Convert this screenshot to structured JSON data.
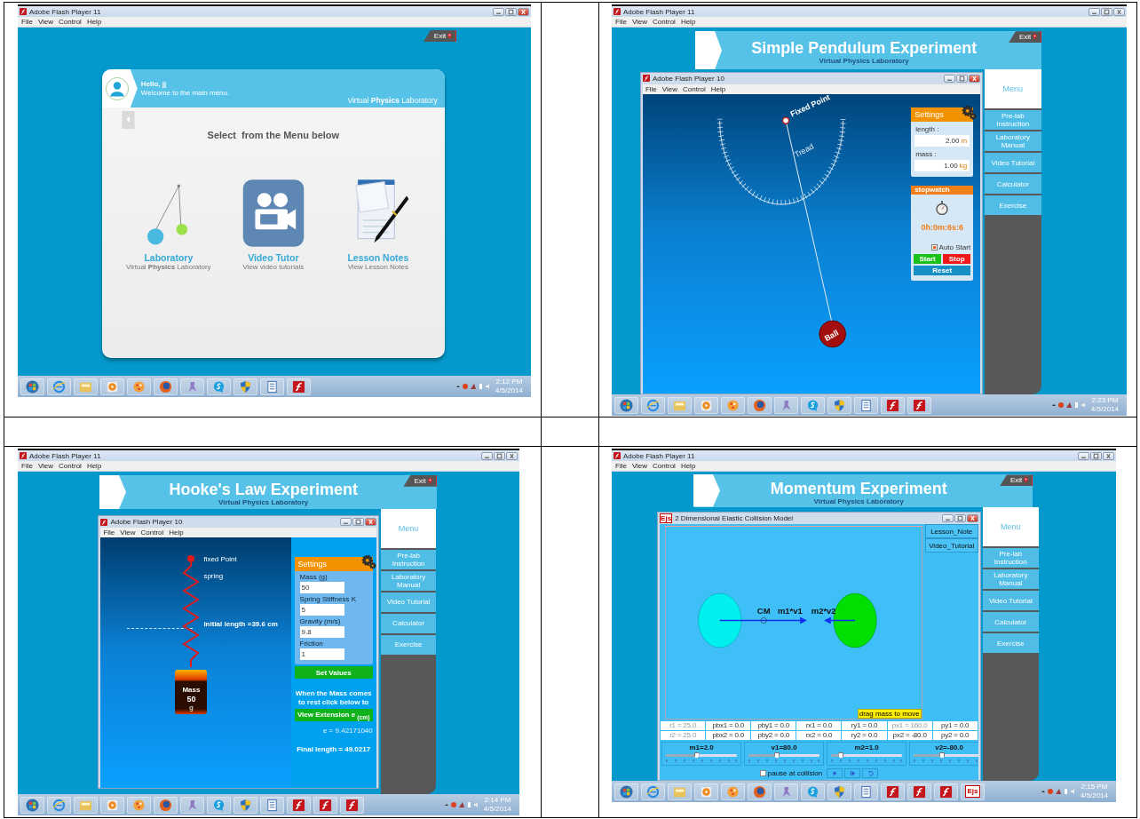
{
  "panels": [
    {
      "kind": "main_menu",
      "window_title": "Adobe Flash Player 11",
      "menus": [
        "File",
        "View",
        "Control",
        "Help"
      ],
      "exit": "Exit",
      "greeting": "Hello, jj",
      "welcome": "Welcome to the main menu.",
      "brand": "Virtual **Physics** Laboratory",
      "prompt": "Select  from the Menu below",
      "options": [
        {
          "kind": "laboratory",
          "title": "Laboratory",
          "subtitle": "Virtual **Physics** Laboratory"
        },
        {
          "kind": "video",
          "title": "Video Tutor",
          "subtitle": "View video tutorials"
        },
        {
          "kind": "notes",
          "title": "Lesson Notes",
          "subtitle": "View Lesson Notes"
        }
      ],
      "taskbar": {
        "items": [
          {
            "kind": "orb"
          },
          {
            "kind": "globe"
          },
          {
            "kind": "folder"
          },
          {
            "kind": "play"
          },
          {
            "kind": "paint"
          },
          {
            "kind": "fox"
          },
          {
            "kind": "pin"
          },
          {
            "kind": "chat"
          },
          {
            "kind": "shield"
          },
          {
            "kind": "document"
          },
          {
            "kind": "flash"
          }
        ],
        "time": "2:12 PM",
        "date": "4/5/2014"
      }
    },
    {
      "kind": "pendulum",
      "window_title": "Adobe Flash Player 11",
      "menus": [
        "File",
        "View",
        "Control",
        "Help"
      ],
      "exit": "Exit",
      "title": "Simple Pendulum Experiment",
      "subtitle": "Virtual Physics Laboratory",
      "menu_title": "Menu",
      "menu_items": [
        "Pre-lab Instruction",
        "Laboratory Manual",
        "Video Tutorial",
        "Calculator",
        "Exercise"
      ],
      "inner": {
        "title": "Adobe Flash Player 10",
        "menus": [
          "File",
          "View",
          "Control",
          "Help"
        ]
      },
      "labels": {
        "fixed_point": "Fixed Point",
        "thread": "Tread",
        "ball": "Ball"
      },
      "settings": {
        "title": "Settings",
        "fields": [
          {
            "label": "length :",
            "value": "2.00",
            "unit": "m"
          },
          {
            "label": "mass :",
            "value": "1.00",
            "unit": "kg"
          }
        ]
      },
      "stopwatch": {
        "title": "stopwatch",
        "reading": "0h:0m:6s:6",
        "auto_start": {
          "label": "Auto Start",
          "checked": true
        },
        "buttons": [
          {
            "kind": "start",
            "label": "Start"
          },
          {
            "kind": "stop",
            "label": "Stop"
          },
          {
            "kind": "reset",
            "label": "Reset"
          }
        ]
      },
      "taskbar": {
        "items": [
          {
            "kind": "orb"
          },
          {
            "kind": "globe"
          },
          {
            "kind": "folder"
          },
          {
            "kind": "play"
          },
          {
            "kind": "paint"
          },
          {
            "kind": "fox"
          },
          {
            "kind": "pin"
          },
          {
            "kind": "chat"
          },
          {
            "kind": "shield"
          },
          {
            "kind": "document"
          },
          {
            "kind": "flash"
          },
          {
            "kind": "flash"
          }
        ],
        "time": "2:23 PM",
        "date": "4/5/2014"
      }
    },
    {
      "kind": "hooke",
      "window_title": "Adobe Flash Player 11",
      "menus": [
        "File",
        "View",
        "Control",
        "Help"
      ],
      "exit": "Exit",
      "title": "Hooke's Law Experiment",
      "subtitle": "Virtual Physics Laboratory",
      "menu_title": "Menu",
      "menu_items": [
        "Pre-lab Instruction",
        "Laboratory Manual",
        "Video Tutorial",
        "Calculator",
        "Exercise"
      ],
      "inner": {
        "title": "Adobe Flash Player 10",
        "menus": [
          "File",
          "View",
          "Control",
          "Help"
        ]
      },
      "labels": {
        "fixed_point": "fixed Point",
        "spring": "spring",
        "initial_length": "initial length =39.6 cm"
      },
      "mass_block": {
        "title": "Mass",
        "value": "50",
        "unit": "g"
      },
      "settings": {
        "title": "Settings",
        "fields": [
          {
            "label": "Mass (g)",
            "value": "50"
          },
          {
            "label": "Spring Stiffness K",
            "value": "5"
          },
          {
            "label": "Gravity (m/s)",
            "value": "9.8"
          },
          {
            "label": "Friction",
            "value": "1"
          }
        ]
      },
      "set_button": "Set Values",
      "note": "When the Mass comes to rest click below to",
      "extension_button": "View Extension e $_{(cm)}$",
      "extension": "e = 9.42171040",
      "final_length": "Final length = 49.0217",
      "taskbar": {
        "items": [
          {
            "kind": "orb"
          },
          {
            "kind": "globe"
          },
          {
            "kind": "folder"
          },
          {
            "kind": "play"
          },
          {
            "kind": "paint"
          },
          {
            "kind": "fox"
          },
          {
            "kind": "pin"
          },
          {
            "kind": "chat"
          },
          {
            "kind": "shield"
          },
          {
            "kind": "document"
          },
          {
            "kind": "flash"
          },
          {
            "kind": "flash"
          },
          {
            "kind": "flash"
          }
        ],
        "time": "2:14 PM",
        "date": "4/5/2014"
      }
    },
    {
      "kind": "momentum",
      "window_title": "Adobe Flash Player 11",
      "menus": [
        "File",
        "View",
        "Control",
        "Help"
      ],
      "exit": "Exit",
      "title": "Momentum Experiment",
      "subtitle": "Virtual Physics Laboratory",
      "menu_title": "Menu",
      "menu_items": [
        "Pre-lab Instruction",
        "Laboratory Manual",
        "Video Tutorial",
        "Calculator",
        "Exercise"
      ],
      "inner": {
        "title": "2 Dimensional Elastic Collision Model",
        "badge": "Ejs"
      },
      "side_buttons": [
        "Lesson_Note",
        "Video_Tutorial"
      ],
      "labels": {
        "cm": "CM",
        "p1": "m1*v1",
        "p2": "m2*v2",
        "hint": "drag mass to move"
      },
      "cells": [
        [
          {
            "text": "r1 = 25.0",
            "disabled": true
          },
          {
            "text": "pbx1 = 0.0",
            "disabled": false
          },
          {
            "text": "pby1 = 0.0",
            "disabled": false
          },
          {
            "text": "rx1 = 0.0",
            "disabled": false
          },
          {
            "text": "ry1 = 0.0",
            "disabled": false
          },
          {
            "text": "px1 = 160.0",
            "disabled": true
          },
          {
            "text": "py1 = 0.0",
            "disabled": false
          }
        ],
        [
          {
            "text": "r2 = 25.0",
            "disabled": true
          },
          {
            "text": "pbx2 = 0.0",
            "disabled": false
          },
          {
            "text": "pby2 = 0.0",
            "disabled": false
          },
          {
            "text": "rx2 = 0.0",
            "disabled": false
          },
          {
            "text": "ry2 = 0.0",
            "disabled": false
          },
          {
            "text": "px2 = -80.0",
            "disabled": false
          },
          {
            "text": "py2 = 0.0",
            "disabled": false
          }
        ]
      ],
      "sliders": [
        {
          "label": "m1=2.0",
          "level": 0.43
        },
        {
          "label": "v1=80.0",
          "level": 0.4
        },
        {
          "label": "m2=1.0",
          "level": 0.14
        },
        {
          "label": "v2=-80.0",
          "level": 0.4
        }
      ],
      "pause": {
        "label": "pause at collision",
        "checked": false
      },
      "taskbar": {
        "items": [
          {
            "kind": "orb"
          },
          {
            "kind": "globe"
          },
          {
            "kind": "folder"
          },
          {
            "kind": "play"
          },
          {
            "kind": "paint"
          },
          {
            "kind": "fox"
          },
          {
            "kind": "pin"
          },
          {
            "kind": "chat"
          },
          {
            "kind": "shield"
          },
          {
            "kind": "document"
          },
          {
            "kind": "flash"
          },
          {
            "kind": "flash"
          },
          {
            "kind": "flash"
          },
          {
            "kind": "ejs",
            "label": "Ejs"
          }
        ],
        "time": "2:15 PM",
        "date": "4/5/2014"
      }
    }
  ]
}
